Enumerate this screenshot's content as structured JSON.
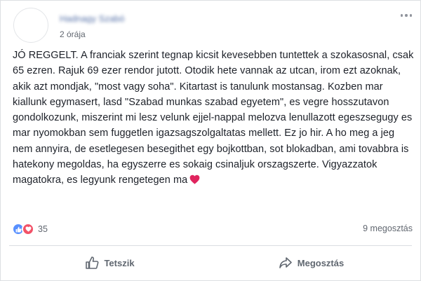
{
  "post": {
    "author": "Hadnagy Szabó",
    "timestamp": "2 órája",
    "text": "JÓ REGGELT. A franciak szerint tegnap kicsit kevesebben tuntettek a szokasosnal, csak 65 ezren. Rajuk 69 ezer rendor jutott. Otodik hete vannak az utcan, irom ezt azoknak, akik azt mondjak, \"most vagy soha\". Kitartast is tanulunk mostansag. Kozben mar kiallunk egymasert, lasd \"Szabad munkas szabad egyetem\", es vegre hosszutavon gondolkozunk, miszerint mi lesz velunk ejjel-nappal melozva lenullazott egeszsegugy es mar nyomokban sem fuggetlen igazsagszolgaltatas mellett. Ez jo hir. A ho meg a jeg nem annyira, de esetlegesen besegithet egy bojkottban, sot blokadban, ami tovabbra is hatekony megoldas, ha egyszerre es sokaig csinaljuk orszagszerte. Vigyazzatok magatokra, es legyunk rengetegen ma",
    "text_emoji": "heart-emoji"
  },
  "reactions": {
    "count": "35",
    "icons": [
      "like-icon",
      "love-icon"
    ],
    "colors": {
      "like": "#5890ff",
      "love": "#f25268"
    }
  },
  "shares": {
    "label": "9 megosztás"
  },
  "actions": {
    "like_label": "Tetszik",
    "share_label": "Megosztás"
  },
  "colors": {
    "text": "#1d2129",
    "secondary": "#616770",
    "heart": "#e0245e"
  }
}
